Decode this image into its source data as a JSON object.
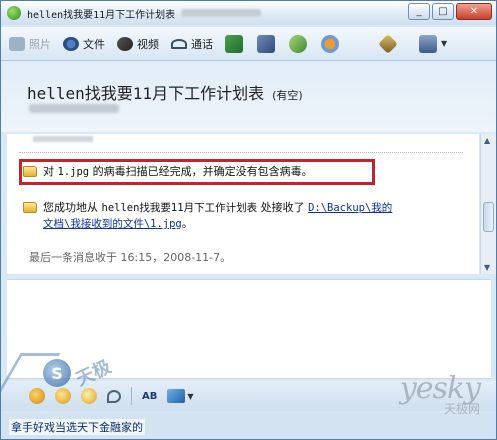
{
  "window": {
    "title": "hellen找我要11月下工作计划表",
    "controls": [
      "minimize",
      "maximize",
      "close"
    ]
  },
  "toolbar": {
    "items": [
      {
        "label": "照片",
        "icon": "photo-icon",
        "enabled": false
      },
      {
        "label": "文件",
        "icon": "file-icon",
        "enabled": true
      },
      {
        "label": "视频",
        "icon": "video-icon",
        "enabled": true
      },
      {
        "label": "通话",
        "icon": "call-icon",
        "enabled": true
      }
    ]
  },
  "contact": {
    "name": "hellen找我要11月下工作计划表",
    "status": "(有空)"
  },
  "messages": [
    {
      "icon": "folder-icon",
      "parts": [
        "对 ",
        "1.jpg",
        " 的病毒扫描已经完成，并确定没有包含病毒。"
      ]
    },
    {
      "icon": "folder-icon",
      "line1_prefix": "您成功地从 ",
      "line1_sender": "hellen找我要11月下工作计划表",
      "line1_mid": " 处接收了 ",
      "line1_link": "D:\\Backup\\我的",
      "line2_link": "文档\\我接收到的文件\\1.jpg",
      "line2_suffix": "。"
    }
  ],
  "last_message": "最后一条消息收于 16:15，2008-11-7。",
  "bottom_toolbar": {
    "font_button": "AB"
  },
  "ad_text": "拿手好戏当选天下金融家的",
  "watermarks": {
    "left_cn": "天极",
    "right": "yesky",
    "right_cn": "天极网"
  },
  "colors": {
    "highlight_border": "#c3232c",
    "link": "#0a2fb2"
  }
}
